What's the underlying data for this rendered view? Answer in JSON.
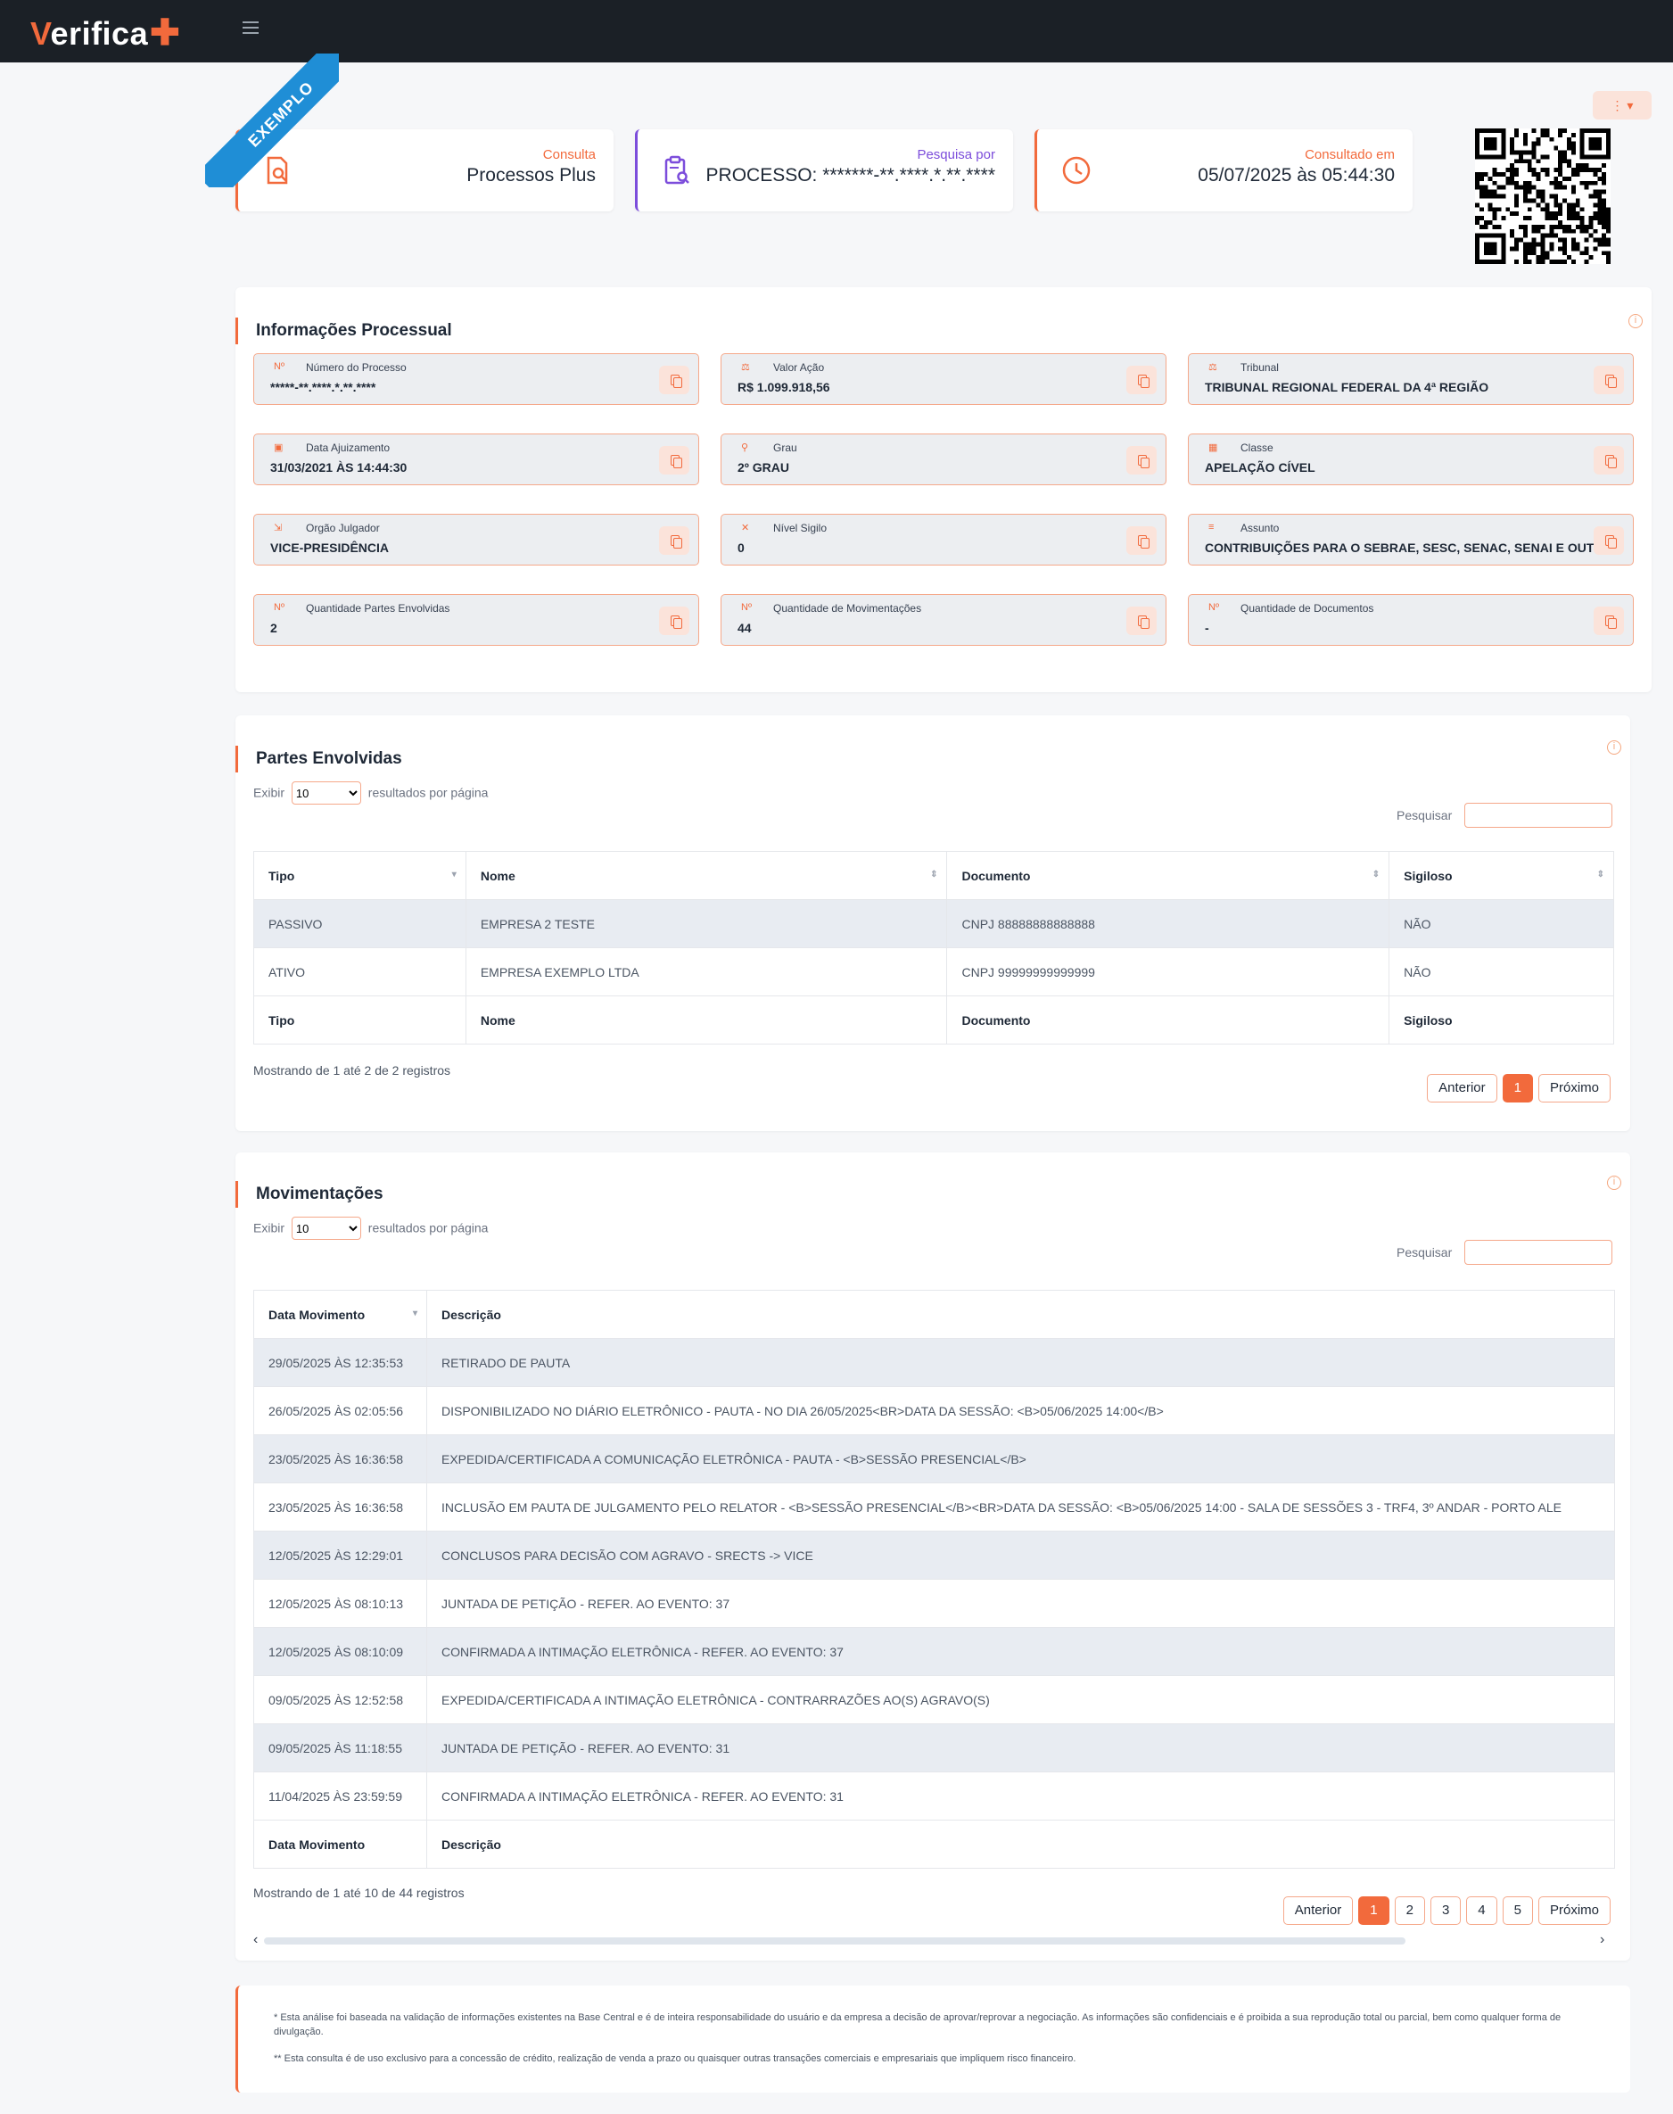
{
  "app": {
    "logo_text": "erifica",
    "logo_v": "V"
  },
  "ribbon": {
    "text": "EXEMPLO"
  },
  "cards": [
    {
      "label": "Consulta",
      "value": "Processos Plus",
      "icon": "document-search-icon",
      "color": "#f26a3c"
    },
    {
      "label": "Pesquisa por",
      "value": "PROCESSO: *******-**.****.*.**.****",
      "icon": "clipboard-search-icon",
      "color": "#7c4ddb"
    },
    {
      "label": "Consultado em",
      "value": "05/07/2025 às 05:44:30",
      "icon": "clock-icon",
      "color": "#f26a3c"
    }
  ],
  "info_section": {
    "title": "Informações Processual",
    "fields": [
      {
        "label": "Número do Processo",
        "value": "*****-**.****.*.**.****",
        "icon": "Nº"
      },
      {
        "label": "Valor Ação",
        "value": "R$ 1.099.918,56",
        "icon": "⚖"
      },
      {
        "label": "Tribunal",
        "value": "TRIBUNAL REGIONAL FEDERAL DA 4ª REGIÃO",
        "icon": "⚖"
      },
      {
        "label": "Data Ajuizamento",
        "value": "31/03/2021 ÀS 14:44:30",
        "icon": "▣"
      },
      {
        "label": "Grau",
        "value": "2º GRAU",
        "icon": "⚲"
      },
      {
        "label": "Classe",
        "value": "APELAÇÃO CÍVEL",
        "icon": "▦"
      },
      {
        "label": "Orgão Julgador",
        "value": "VICE-PRESIDÊNCIA",
        "icon": "⇲"
      },
      {
        "label": "Nível Sigilo",
        "value": "0",
        "icon": "✕"
      },
      {
        "label": "Assunto",
        "value": "CONTRIBUIÇÕES PARA O SEBRAE, SESC, SENAC, SENAI E OUTROS",
        "icon": "≡"
      },
      {
        "label": "Quantidade Partes Envolvidas",
        "value": "2",
        "icon": "Nº"
      },
      {
        "label": "Quantidade de Movimentações",
        "value": "44",
        "icon": "Nº"
      },
      {
        "label": "Quantidade de Documentos",
        "value": "-",
        "icon": "Nº"
      }
    ]
  },
  "partes": {
    "title": "Partes Envolvidas",
    "exibir": "Exibir",
    "per_page": "10",
    "resultados": "resultados por página",
    "search_label": "Pesquisar",
    "columns": [
      "Tipo",
      "Nome",
      "Documento",
      "Sigiloso"
    ],
    "rows": [
      [
        "PASSIVO",
        "EMPRESA 2 TESTE",
        "CNPJ 88888888888888",
        "NÃO"
      ],
      [
        "ATIVO",
        "EMPRESA EXEMPLO LTDA",
        "CNPJ 99999999999999",
        "NÃO"
      ]
    ],
    "showing": "Mostrando de 1 até 2 de 2 registros",
    "pager": {
      "prev": "Anterior",
      "pages": [
        "1"
      ],
      "next": "Próximo"
    }
  },
  "movimentacoes": {
    "title": "Movimentações",
    "exibir": "Exibir",
    "per_page": "10",
    "resultados": "resultados por página",
    "search_label": "Pesquisar",
    "columns": [
      "Data Movimento",
      "Descrição"
    ],
    "rows": [
      [
        "29/05/2025 ÀS 12:35:53",
        "RETIRADO DE PAUTA"
      ],
      [
        "26/05/2025 ÀS 02:05:56",
        "DISPONIBILIZADO NO DIÁRIO ELETRÔNICO - PAUTA - NO DIA 26/05/2025<BR>DATA DA SESSÃO: <B>05/06/2025 14:00</B>"
      ],
      [
        "23/05/2025 ÀS 16:36:58",
        "EXPEDIDA/CERTIFICADA A COMUNICAÇÃO ELETRÔNICA - PAUTA - <B>SESSÃO PRESENCIAL</B>"
      ],
      [
        "23/05/2025 ÀS 16:36:58",
        "INCLUSÃO EM PAUTA DE JULGAMENTO PELO RELATOR - <B>SESSÃO PRESENCIAL</B><BR>DATA DA SESSÃO: <B>05/06/2025 14:00 - SALA DE SESSÕES 3 - TRF4, 3º ANDAR - PORTO ALE"
      ],
      [
        "12/05/2025 ÀS 12:29:01",
        "CONCLUSOS PARA DECISÃO COM AGRAVO - SRECTS -> VICE"
      ],
      [
        "12/05/2025 ÀS 08:10:13",
        "JUNTADA DE PETIÇÃO - REFER. AO EVENTO: 37"
      ],
      [
        "12/05/2025 ÀS 08:10:09",
        "CONFIRMADA A INTIMAÇÃO ELETRÔNICA - REFER. AO EVENTO: 37"
      ],
      [
        "09/05/2025 ÀS 12:52:58",
        "EXPEDIDA/CERTIFICADA A INTIMAÇÃO ELETRÔNICA - CONTRARRAZÕES AO(S) AGRAVO(S)"
      ],
      [
        "09/05/2025 ÀS 11:18:55",
        "JUNTADA DE PETIÇÃO - REFER. AO EVENTO: 31"
      ],
      [
        "11/04/2025 ÀS 23:59:59",
        "CONFIRMADA A INTIMAÇÃO ELETRÔNICA - REFER. AO EVENTO: 31"
      ]
    ],
    "showing": "Mostrando de 1 até 10 de 44 registros",
    "pager": {
      "prev": "Anterior",
      "pages": [
        "1",
        "2",
        "3",
        "4",
        "5"
      ],
      "next": "Próximo"
    }
  },
  "footer": {
    "note1": "* Esta análise foi baseada na validação de informações existentes na Base Central e é de inteira responsabilidade do usuário e da empresa a decisão de aprovar/reprovar a negociação. As informações são confidenciais e é proibida a sua reprodução total ou parcial, bem como qualquer forma de divulgação.",
    "note2": "** Esta consulta é de uso exclusivo para a concessão de crédito, realização de venda a prazo ou quaisquer outras transações comerciais e empresariais que impliquem risco financeiro."
  },
  "colors": {
    "accent": "#f26a3c",
    "purple": "#7c4ddb",
    "ribbon": "#1f8ed6",
    "topbar": "#1b2026"
  }
}
